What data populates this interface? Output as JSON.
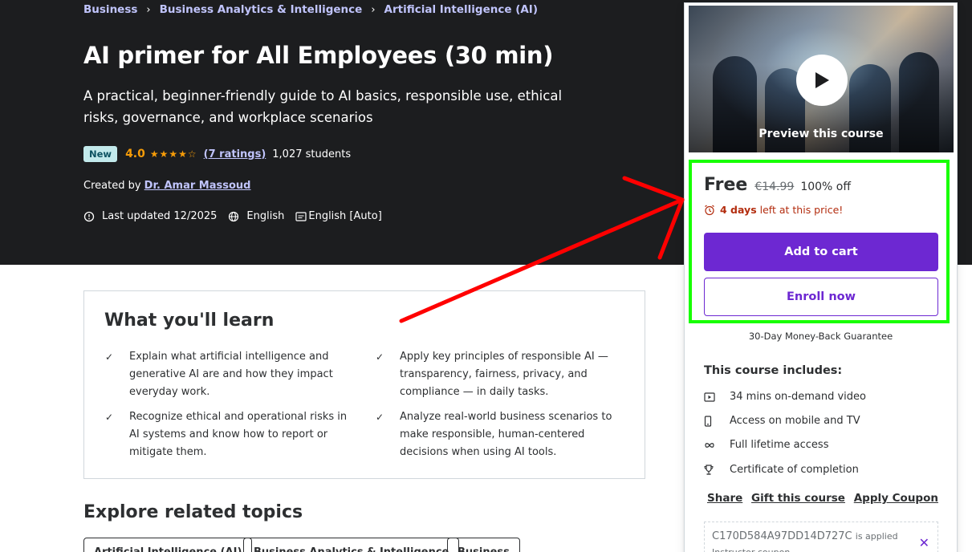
{
  "breadcrumb": [
    "Business",
    "Business Analytics & Intelligence",
    "Artificial Intelligence (AI)"
  ],
  "course": {
    "title": "AI primer for All Employees (30 min)",
    "subtitle": "A practical, beginner-friendly guide to AI basics, responsible use, ethical risks, governance, and workplace scenarios",
    "badge": "New",
    "rating": "4.0",
    "rating_stars": 4,
    "ratings_count": "(7 ratings)",
    "students": "1,027 students",
    "created_by_label": "Created by",
    "instructor": "Dr. Amar Massoud",
    "last_updated": "Last updated 12/2025",
    "language": "English",
    "captions": "English [Auto]"
  },
  "learn": {
    "title": "What you'll learn",
    "items": [
      "Explain what artificial intelligence and generative AI are and how they impact everyday work.",
      "Apply key principles of responsible AI — transparency, fairness, privacy, and compliance — in daily tasks.",
      "Recognize ethical and operational risks in AI systems and know how to report or mitigate them.",
      "Analyze real-world business scenarios to make responsible, human-centered decisions when using AI tools."
    ]
  },
  "related": {
    "title": "Explore related topics",
    "topics": [
      "Artificial Intelligence (AI)",
      "Business Analytics & Intelligence",
      "Business"
    ]
  },
  "sidebar": {
    "preview_label": "Preview this course",
    "price": "Free",
    "original_price": "€14.99",
    "discount": "100% off",
    "timer_bold": "4 days",
    "timer_rest": "left at this price!",
    "add_to_cart": "Add to cart",
    "enroll_now": "Enroll now",
    "guarantee": "30-Day Money-Back Guarantee",
    "includes_title": "This course includes:",
    "includes": [
      {
        "icon": "video-icon",
        "text": "34 mins on-demand video"
      },
      {
        "icon": "mobile-icon",
        "text": "Access on mobile and TV"
      },
      {
        "icon": "infinity-icon",
        "text": "Full lifetime access"
      },
      {
        "icon": "trophy-icon",
        "text": "Certificate of completion"
      }
    ],
    "actions": [
      "Share",
      "Gift this course",
      "Apply Coupon"
    ],
    "coupon_code": "C170D584A97DD14D727C",
    "coupon_applied": "is applied",
    "coupon_type": "Instructor coupon"
  },
  "colors": {
    "hero_bg": "#1c1d1f",
    "link_purple": "#c0c4fc",
    "brand_purple": "#6d28d2",
    "star_orange": "#f69c08",
    "timer_red": "#b32d0f",
    "annotation_green": "#17ff00",
    "annotation_red": "#ff0000"
  }
}
